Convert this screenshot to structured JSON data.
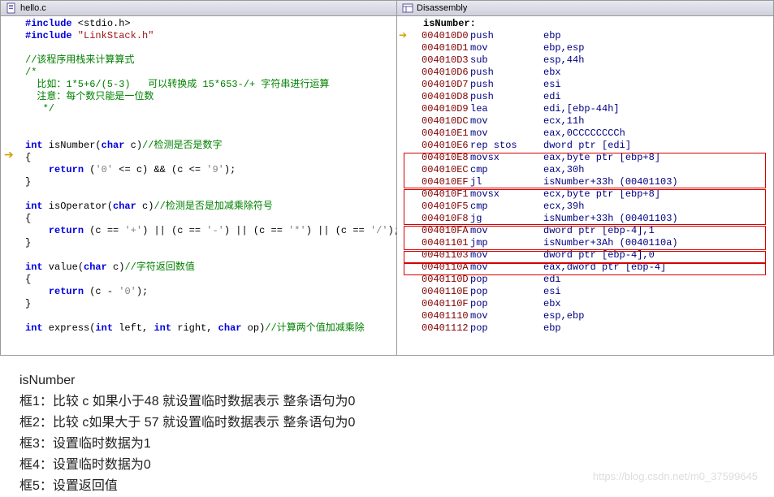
{
  "codeTab": {
    "title": "hello.c"
  },
  "disasmTab": {
    "title": "Disassembly"
  },
  "code": {
    "inc1a": "#include",
    "inc1b": " <stdio.h>",
    "inc2a": "#include",
    "inc2b": " \"LinkStack.h\"",
    "c1": "//该程序用栈来计算算式",
    "c2": "/*",
    "c3": "  比如：1*5+6/(5-3)   可以转换成 15*653-/+ 字符串进行运算",
    "c4": "  注意：每个数只能是一位数",
    "c5": "   */",
    "fn1_t1": "int",
    "fn1_name": " isNumber(",
    "fn1_t2": "char",
    "fn1_rest": " c)",
    "fn1_cmt": "//检测是否是数字",
    "fn1_body": "    return ('0' <= c) && (c <= '9');",
    "fn2_t1": "int",
    "fn2_name": " isOperator(",
    "fn2_t2": "char",
    "fn2_rest": " c)",
    "fn2_cmt": "//检测是否是加减乘除符号",
    "fn2_body": "    return (c == '+') || (c == '-') || (c == '*') || (c == '/');",
    "fn3_t1": "int",
    "fn3_name": " value(",
    "fn3_t2": "char",
    "fn3_rest": " c)",
    "fn3_cmt": "//字符返回数值",
    "fn3_body": "    return (c - '0');",
    "fn4_t1": "int",
    "fn4_name": " express(",
    "fn4_t2": "int",
    "fn4_p1": " left, ",
    "fn4_t3": "int",
    "fn4_p2": " right, ",
    "fn4_t4": "char",
    "fn4_p3": " op)",
    "fn4_cmt": "//计算两个值加减乘除",
    "brace_open": "{",
    "brace_close": "}"
  },
  "disasm": {
    "header": "isNumber:",
    "lines": [
      {
        "addr": "004010D0",
        "op": "push",
        "args": "ebp",
        "arrow": true
      },
      {
        "addr": "004010D1",
        "op": "mov",
        "args": "ebp,esp"
      },
      {
        "addr": "004010D3",
        "op": "sub",
        "args": "esp,44h"
      },
      {
        "addr": "004010D6",
        "op": "push",
        "args": "ebx"
      },
      {
        "addr": "004010D7",
        "op": "push",
        "args": "esi"
      },
      {
        "addr": "004010D8",
        "op": "push",
        "args": "edi"
      },
      {
        "addr": "004010D9",
        "op": "lea",
        "args": "edi,[ebp-44h]"
      },
      {
        "addr": "004010DC",
        "op": "mov",
        "args": "ecx,11h"
      },
      {
        "addr": "004010E1",
        "op": "mov",
        "args": "eax,0CCCCCCCCh"
      },
      {
        "addr": "004010E6",
        "op": "rep stos",
        "args": "dword ptr [edi]"
      },
      {
        "addr": "004010E8",
        "op": "movsx",
        "args": "eax,byte ptr [ebp+8]"
      },
      {
        "addr": "004010EC",
        "op": "cmp",
        "args": "eax,30h"
      },
      {
        "addr": "004010EF",
        "op": "jl",
        "args": "isNumber+33h (00401103)"
      },
      {
        "addr": "004010F1",
        "op": "movsx",
        "args": "ecx,byte ptr [ebp+8]"
      },
      {
        "addr": "004010F5",
        "op": "cmp",
        "args": "ecx,39h"
      },
      {
        "addr": "004010F8",
        "op": "jg",
        "args": "isNumber+33h (00401103)"
      },
      {
        "addr": "004010FA",
        "op": "mov",
        "args": "dword ptr [ebp-4],1"
      },
      {
        "addr": "00401101",
        "op": "jmp",
        "args": "isNumber+3Ah (0040110a)"
      },
      {
        "addr": "00401103",
        "op": "mov",
        "args": "dword ptr [ebp-4],0"
      },
      {
        "addr": "0040110A",
        "op": "mov",
        "args": "eax,dword ptr [ebp-4]"
      },
      {
        "addr": "0040110D",
        "op": "pop",
        "args": "edi"
      },
      {
        "addr": "0040110E",
        "op": "pop",
        "args": "esi"
      },
      {
        "addr": "0040110F",
        "op": "pop",
        "args": "ebx"
      },
      {
        "addr": "00401110",
        "op": "mov",
        "args": "esp,ebp"
      },
      {
        "addr": "00401112",
        "op": "pop",
        "args": "ebp"
      }
    ]
  },
  "below": {
    "l1": "isNumber",
    "l2": "框1：比较 c 如果小于48 就设置临时数据表示 整条语句为0",
    "l3": "框2：比较 c如果大于 57 就设置临时数据表示 整条语句为0",
    "l4": "框3：设置临时数据为1",
    "l5": "框4：设置临时数据为0",
    "l6": "框5：设置返回值"
  },
  "watermark": "https://blog.csdn.net/m0_37599645"
}
